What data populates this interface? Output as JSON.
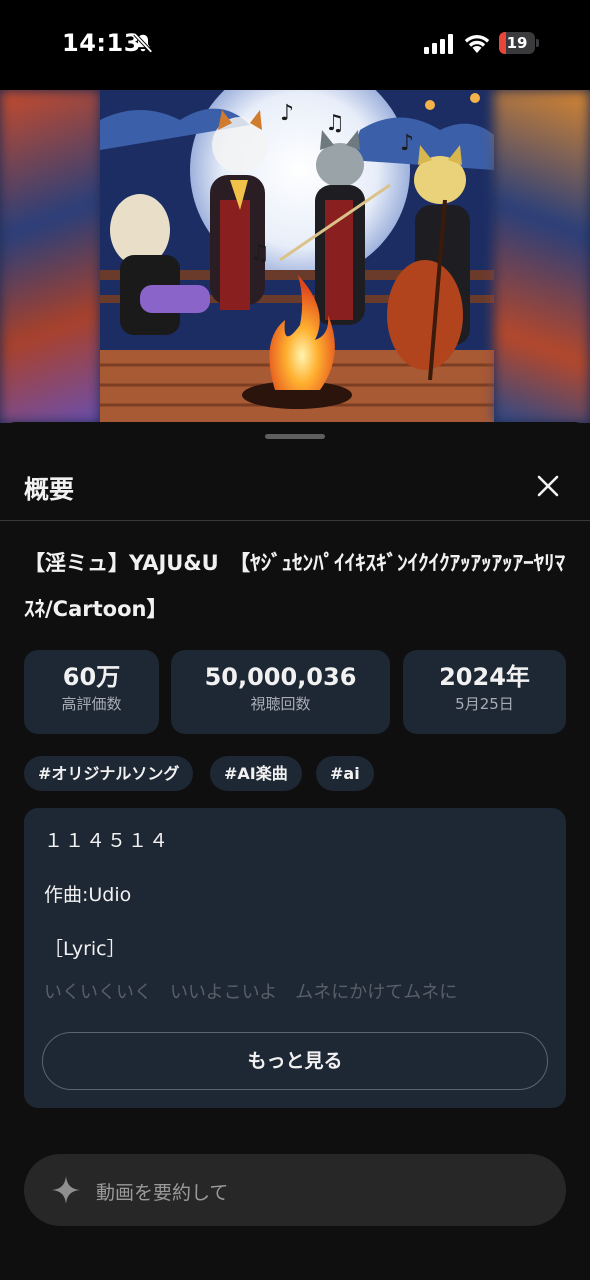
{
  "status_bar": {
    "time": "14:13",
    "battery_level": "19",
    "battery_fraction": 0.19,
    "battery_color": "#e9453a",
    "icons": [
      "bell-off-icon",
      "cellular-signal-icon",
      "wifi-icon",
      "battery-icon"
    ]
  },
  "video": {
    "thumbnail_icon": "video-thumbnail"
  },
  "panel": {
    "title": "概要",
    "close_icon": "close-icon"
  },
  "video_info": {
    "title": "【淫ミュ】YAJU&U　【ﾔｼﾞｭｾﾝﾊﾟｲｲｷｽｷﾞﾝｲｸｲｸｱｯｱｯｱｯｱｰﾔﾘﾏｽﾈ/Cartoon】",
    "stats": [
      {
        "value": "60万",
        "label": "高評価数"
      },
      {
        "value": "50,000,036",
        "label": "視聴回数"
      },
      {
        "value": "2024年",
        "label": "5月25日"
      }
    ],
    "tags": [
      "#オリジナルソング",
      "#AI楽曲",
      "#ai"
    ]
  },
  "description": {
    "line1": "１１４５１４",
    "line2": "作曲:Udio",
    "line3": "［Lyric］",
    "faded_line": "いくいくいく　いいよこいよ　ムネにかけてムネに",
    "more_label": "もっと見る"
  },
  "ask": {
    "placeholder": "動画を要約して",
    "icon": "sparkle-icon"
  },
  "colors": {
    "background": "#0f0f0f",
    "card": "#1e2734",
    "input_bar": "#272727"
  }
}
